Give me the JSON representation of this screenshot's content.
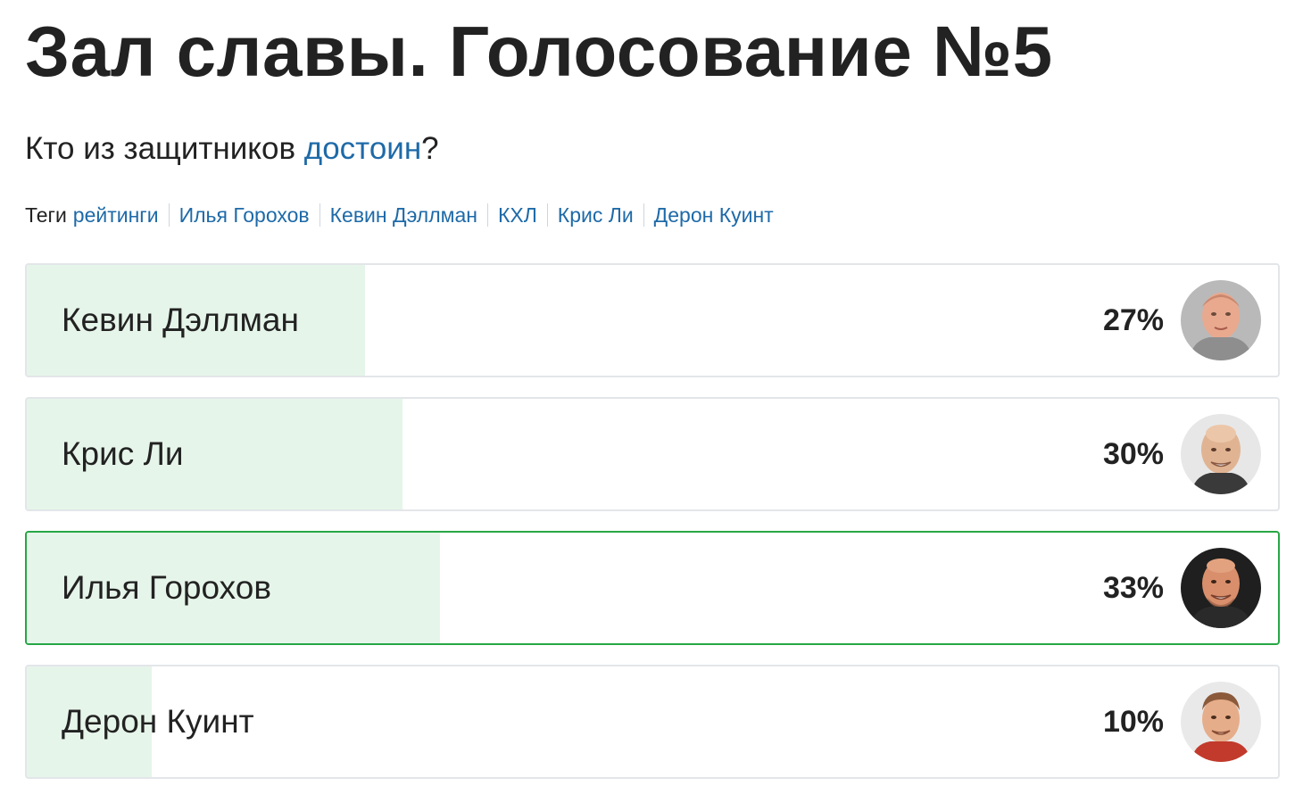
{
  "title": "Зал славы. Голосование №5",
  "question": {
    "text_before": "Кто из защитников ",
    "link_text": "достоин",
    "text_after": "?"
  },
  "tags": {
    "label": "Теги",
    "items": [
      "рейтинги",
      "Илья Горохов",
      "Кевин Дэллман",
      "КХЛ",
      "Крис Ли",
      "Дерон Куинт"
    ]
  },
  "poll": {
    "options": [
      {
        "name": "Кевин Дэллман",
        "percent_label": "27%",
        "percent": 27,
        "selected": false,
        "avatar_icon": "player-photo-dallman"
      },
      {
        "name": "Крис Ли",
        "percent_label": "30%",
        "percent": 30,
        "selected": false,
        "avatar_icon": "player-photo-lee"
      },
      {
        "name": "Илья Горохов",
        "percent_label": "33%",
        "percent": 33,
        "selected": true,
        "avatar_icon": "player-photo-gorokhov"
      },
      {
        "name": "Дерон Куинт",
        "percent_label": "10%",
        "percent": 10,
        "selected": false,
        "avatar_icon": "player-photo-quint"
      }
    ]
  },
  "colors": {
    "link": "#1e6aa8",
    "result_fill": "#e6f5ea",
    "selected_border": "#27a745",
    "default_border": "#e3e6e9"
  }
}
